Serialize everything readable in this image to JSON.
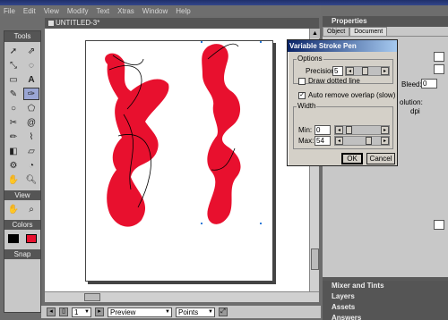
{
  "menu": [
    "File",
    "Edit",
    "View",
    "Modify",
    "Text",
    "Xtras",
    "Window",
    "Help"
  ],
  "toolbox": {
    "title": "Tools",
    "view_label": "View",
    "colors_label": "Colors",
    "snap_label": "Snap",
    "stroke_color": "#000000",
    "fill_color": "#e8102e"
  },
  "document": {
    "tab_title": "UNTITLED-3*",
    "shape_color": "#e8102e"
  },
  "statusbar": {
    "page_value": "1",
    "preview_label": "Preview",
    "units_label": "Points"
  },
  "properties": {
    "title": "Properties",
    "tabs": [
      "Object",
      "Document"
    ],
    "bleed_label": "Bleed:",
    "bleed_value": "0",
    "resolution_label": "olution:",
    "dpi_label": "dpi"
  },
  "collapsed_panels": [
    "Mixer and Tints",
    "Layers",
    "Assets",
    "Answers"
  ],
  "dialog": {
    "title": "Variable Stroke Pen",
    "options_label": "Options",
    "precision_label": "Precision:",
    "precision_value": "5",
    "draw_dotted_label": "Draw dotted line",
    "draw_dotted_checked": false,
    "auto_remove_label": "Auto remove overlap (slow)",
    "auto_remove_checked": true,
    "width_label": "Width",
    "min_label": "Min:",
    "min_value": "0",
    "max_label": "Max:",
    "max_value": "54",
    "ok_label": "OK",
    "cancel_label": "Cancel"
  }
}
